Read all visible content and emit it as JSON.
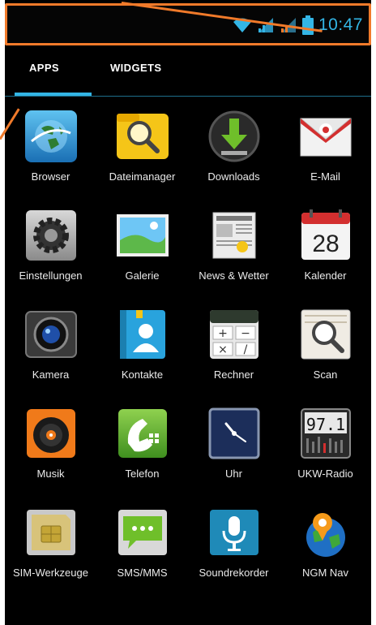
{
  "status_bar": {
    "time": "10:47",
    "icons": [
      "wifi-icon",
      "signal-icon",
      "signal-icon",
      "battery-icon"
    ],
    "accent_color": "#33b5e5",
    "annotation_color": "#f07a2a"
  },
  "tabs": [
    {
      "label": "APPS",
      "active": true
    },
    {
      "label": "WIDGETS",
      "active": false
    }
  ],
  "apps": [
    {
      "label": "Browser",
      "icon": "globe-icon"
    },
    {
      "label": "Dateimanager",
      "icon": "folder-search-icon"
    },
    {
      "label": "Downloads",
      "icon": "download-icon"
    },
    {
      "label": "E-Mail",
      "icon": "envelope-icon"
    },
    {
      "label": "Einstellungen",
      "icon": "gear-icon"
    },
    {
      "label": "Galerie",
      "icon": "picture-icon"
    },
    {
      "label": "News & Wetter",
      "icon": "newspaper-icon"
    },
    {
      "label": "Kalender",
      "icon": "calendar-icon",
      "calendar_day": "28"
    },
    {
      "label": "Kamera",
      "icon": "camera-icon"
    },
    {
      "label": "Kontakte",
      "icon": "contacts-icon"
    },
    {
      "label": "Rechner",
      "icon": "calculator-icon"
    },
    {
      "label": "Scan",
      "icon": "scan-icon"
    },
    {
      "label": "Musik",
      "icon": "music-icon"
    },
    {
      "label": "Telefon",
      "icon": "phone-icon"
    },
    {
      "label": "Uhr",
      "icon": "clock-icon"
    },
    {
      "label": "UKW-Radio",
      "icon": "radio-icon",
      "radio_display": "97.1"
    },
    {
      "label": "SIM-Werkzeuge",
      "icon": "sim-card-icon"
    },
    {
      "label": "SMS/MMS",
      "icon": "message-icon"
    },
    {
      "label": "Soundrekorder",
      "icon": "microphone-icon"
    },
    {
      "label": "NGM Nav",
      "icon": "navigation-globe-icon"
    }
  ]
}
